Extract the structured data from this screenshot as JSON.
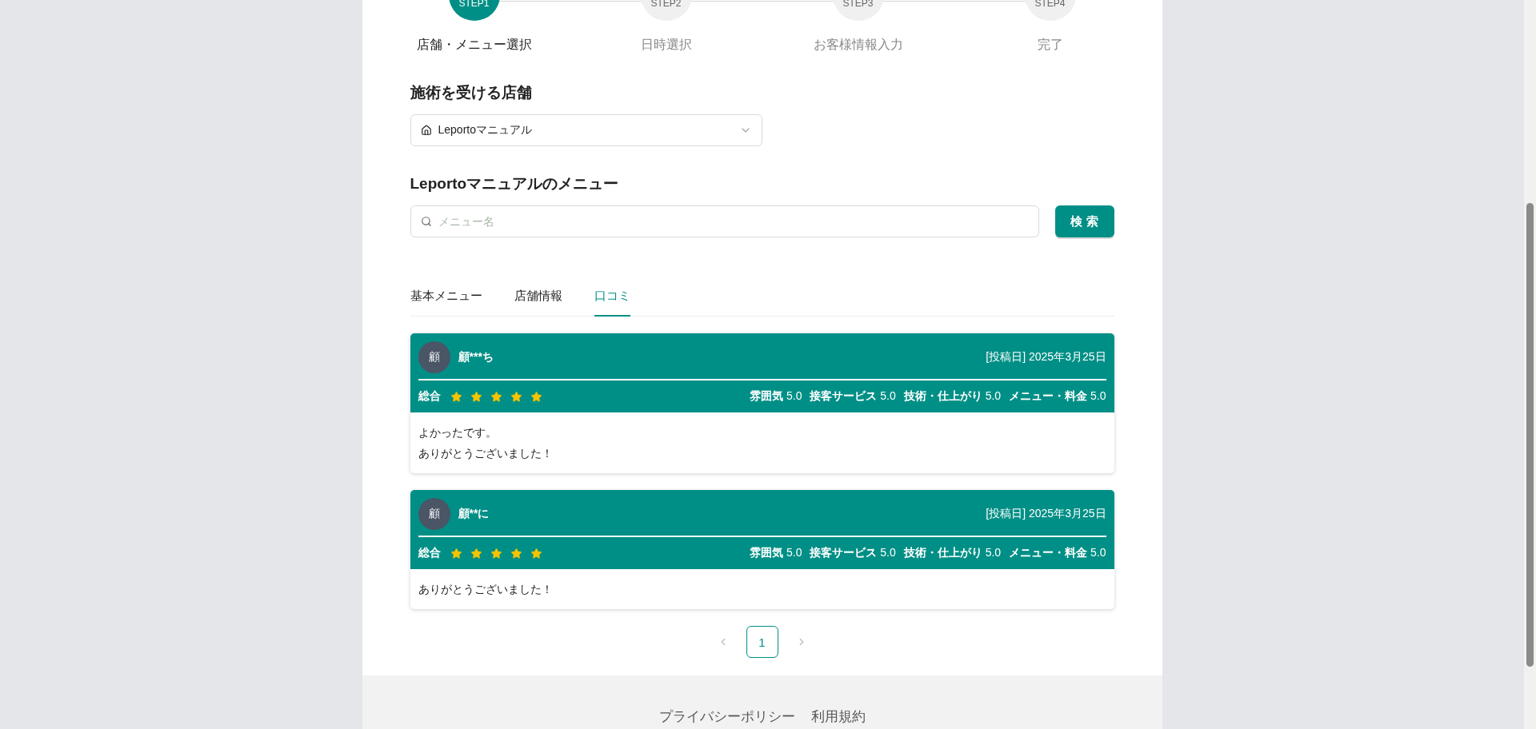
{
  "steps": [
    {
      "badge": "STEP1",
      "label": "店舗・メニュー選択",
      "selected": true
    },
    {
      "badge": "STEP2",
      "label": "日時選択",
      "selected": false
    },
    {
      "badge": "STEP3",
      "label": "お客様情報入力",
      "selected": false
    },
    {
      "badge": "STEP4",
      "label": "完了",
      "selected": false
    }
  ],
  "store_section": {
    "title": "施術を受ける店舗",
    "select_value": "Leportoマニュアル"
  },
  "menu_section": {
    "title": "Leportoマニュアルのメニュー",
    "search_placeholder": "メニュー名",
    "search_button": "検 索"
  },
  "tabs": [
    {
      "label": "基本メニュー",
      "selected": false
    },
    {
      "label": "店舗情報",
      "selected": false
    },
    {
      "label": "口コミ",
      "selected": true
    }
  ],
  "reviews": [
    {
      "avatar": "顧",
      "name": "顧***ち",
      "date": "[投稿日] 2025年3月25日",
      "overall_label": "総合",
      "stars": 5,
      "ratings": [
        {
          "label": "雰囲気",
          "value": "5.0"
        },
        {
          "label": "接客サービス",
          "value": "5.0"
        },
        {
          "label": "技術・仕上がり",
          "value": "5.0"
        },
        {
          "label": "メニュー・料金",
          "value": "5.0"
        }
      ],
      "body": [
        "よかったです。",
        "ありがとうございました！"
      ]
    },
    {
      "avatar": "顧",
      "name": "顧**に",
      "date": "[投稿日] 2025年3月25日",
      "overall_label": "総合",
      "stars": 5,
      "ratings": [
        {
          "label": "雰囲気",
          "value": "5.0"
        },
        {
          "label": "接客サービス",
          "value": "5.0"
        },
        {
          "label": "技術・仕上がり",
          "value": "5.0"
        },
        {
          "label": "メニュー・料金",
          "value": "5.0"
        }
      ],
      "body": [
        "ありがとうございました！"
      ]
    }
  ],
  "pagination": {
    "pages": [
      {
        "label": "1",
        "selected": true
      }
    ]
  },
  "footer": {
    "links": [
      "プライバシーポリシー",
      "利用規約"
    ]
  }
}
